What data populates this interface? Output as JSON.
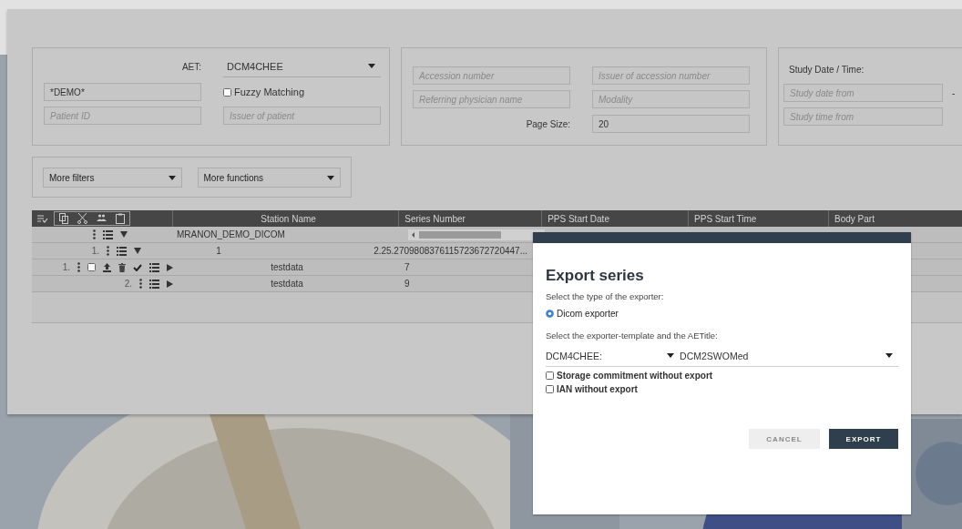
{
  "filters": {
    "aet_label": "AET:",
    "aet": "DCM4CHEE",
    "patient_name": {
      "value": "*DEMO*"
    },
    "fuzzy": {
      "label": "Fuzzy Matching",
      "checked": false
    },
    "patient_id": {
      "placeholder": "Patient ID"
    },
    "issuer_of_patient": {
      "placeholder": "Issuer of patient"
    }
  },
  "filters_2": {
    "accession": {
      "placeholder": "Accession number"
    },
    "issuer_of_accession": {
      "placeholder": "Issuer of accession number"
    },
    "referring_physician": {
      "placeholder": "Referring physician name"
    },
    "modality": {
      "placeholder": "Modality"
    },
    "page_size_label": "Page Size:",
    "page_size": {
      "value": "20"
    }
  },
  "study_date": {
    "label": "Study Date / Time:",
    "date_from": {
      "placeholder": "Study date from"
    },
    "time_from": {
      "placeholder": "Study time from"
    },
    "separator": "-"
  },
  "menus": [
    "More filters",
    "More functions"
  ],
  "table": {
    "columns": [
      "Station Name",
      "Series Number",
      "PPS Start Date",
      "PPS Start Time",
      "Body Part"
    ],
    "rows": [
      {
        "kind": "patient",
        "station_name": "MRANON_DEMO_DICOM",
        "expanded": true
      },
      {
        "kind": "study",
        "index": "1.",
        "station_name": "1",
        "series_number": "2.25.2709808376115723672720447...",
        "expanded": true
      },
      {
        "kind": "series",
        "index": "1.",
        "checked": false,
        "station_name": "testdata",
        "series_number": "7",
        "expanded": false
      },
      {
        "kind": "series",
        "index": "2.",
        "station_name": "testdata",
        "series_number": "9",
        "expanded": false
      }
    ]
  },
  "dialog": {
    "title": "Export series",
    "type_prompt": "Select the type of the exporter:",
    "exporter": {
      "label": "Dicom exporter",
      "selected": true
    },
    "template_prompt": "Select the exporter-template and the AETitle:",
    "template": "DCM4CHEE:",
    "aet": "DCM2SWOMed",
    "options": [
      {
        "label": "Storage commitment without export",
        "checked": false
      },
      {
        "label": "IAN without export",
        "checked": false
      }
    ],
    "buttons": [
      {
        "label": "CANCEL",
        "kind": "secondary"
      },
      {
        "label": "EXPORT",
        "kind": "primary"
      }
    ]
  }
}
